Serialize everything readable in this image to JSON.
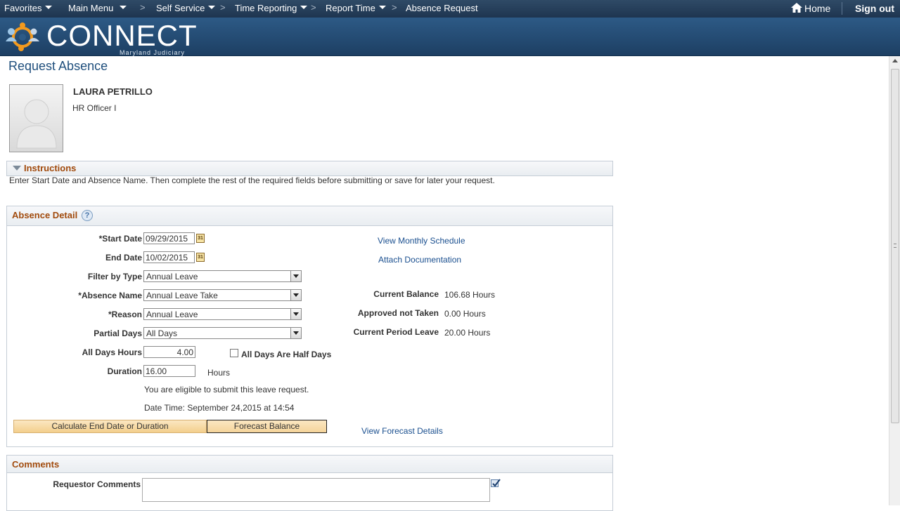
{
  "nav": {
    "favorites": "Favorites",
    "main_menu": "Main Menu",
    "self_service": "Self Service",
    "time_reporting": "Time Reporting",
    "report_time": "Report Time",
    "absence_request": "Absence Request",
    "home": "Home",
    "sign_out": "Sign out",
    "separator": ">"
  },
  "banner": {
    "logo_text": "CONNECT",
    "logo_subtitle": "Maryland Judiciary"
  },
  "page": {
    "title": "Request Absence"
  },
  "employee": {
    "name": "LAURA PETRILLO",
    "title": "HR Officer I"
  },
  "instructions": {
    "header": "Instructions",
    "text": "Enter Start Date and Absence Name. Then complete the rest of the required fields before submitting or save for later your request."
  },
  "absence_detail": {
    "header": "Absence Detail",
    "help": "?",
    "start_date_label": "*Start Date",
    "start_date": "09/29/2015",
    "end_date_label": "End Date",
    "end_date": "10/02/2015",
    "calendar_glyph": "31",
    "filter_type_label": "Filter by Type",
    "filter_type": "Annual Leave",
    "absence_name_label": "*Absence Name",
    "absence_name": "Annual Leave Take",
    "reason_label": "*Reason",
    "reason": "Annual Leave",
    "partial_days_label": "Partial Days",
    "partial_days": "All Days",
    "all_days_hours_label": "All Days Hours",
    "all_days_hours": "4.00",
    "half_days_label": "All Days Are Half Days",
    "duration_label": "Duration",
    "duration": "16.00",
    "duration_unit": "Hours",
    "eligibility_msg": "You are eligible to submit this leave request.",
    "date_time": "Date Time: September 24,2015 at 14:54",
    "view_monthly_schedule": "View Monthly Schedule",
    "attach_documentation": "Attach Documentation",
    "current_balance_label": "Current Balance",
    "current_balance": "106.68 Hours",
    "approved_not_taken_label": "Approved not Taken",
    "approved_not_taken": "0.00 Hours",
    "current_period_leave_label": "Current Period Leave",
    "current_period_leave": "20.00 Hours",
    "calc_button": "Calculate End Date or Duration",
    "forecast_button": "Forecast Balance",
    "view_forecast_details": "View Forecast Details"
  },
  "comments": {
    "header": "Comments",
    "requestor_label": "Requestor Comments",
    "requestor_value": ""
  }
}
